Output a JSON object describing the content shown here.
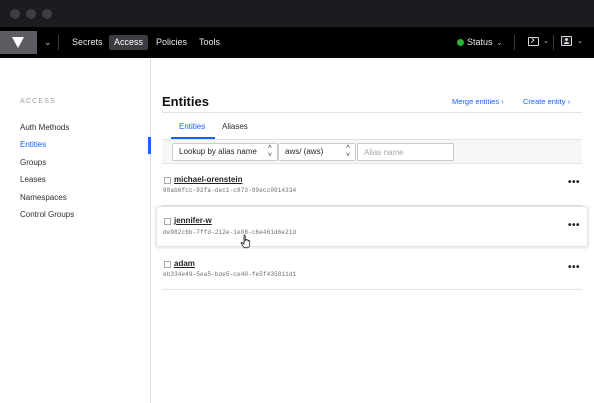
{
  "nav": {
    "links": [
      "Secrets",
      "Access",
      "Policies",
      "Tools"
    ],
    "active": "Access",
    "status_label": "Status"
  },
  "sidebar": {
    "heading": "ACCESS",
    "items": [
      "Auth Methods",
      "Entities",
      "Groups",
      "Leases",
      "Namespaces",
      "Control Groups"
    ],
    "active": "Entities"
  },
  "main": {
    "title": "Entities",
    "merge_link": "Merge entities",
    "create_link": "Create entity",
    "tabs": [
      "Entities",
      "Aliases"
    ],
    "active_tab": "Entities",
    "lookup_select": "Lookup by alias name",
    "mount_select": "aws/ (aws)",
    "alias_placeholder": "Alias name",
    "rows": [
      {
        "name": "michael-orenstein",
        "id": "98ab6fcc-92fa-dec1-c873-99ecc0914334"
      },
      {
        "name": "jennifer-w",
        "id": "de982c6b-7ffd-212e-1e08-c6e461d6e21d"
      },
      {
        "name": "adam",
        "id": "eb334e49-5ea5-bde5-ce40-fe5f435811d1"
      }
    ],
    "more_label": "•••"
  },
  "colors": {
    "accent": "#1563ff",
    "navbar": "#000000",
    "status_ok": "#2eb039"
  }
}
